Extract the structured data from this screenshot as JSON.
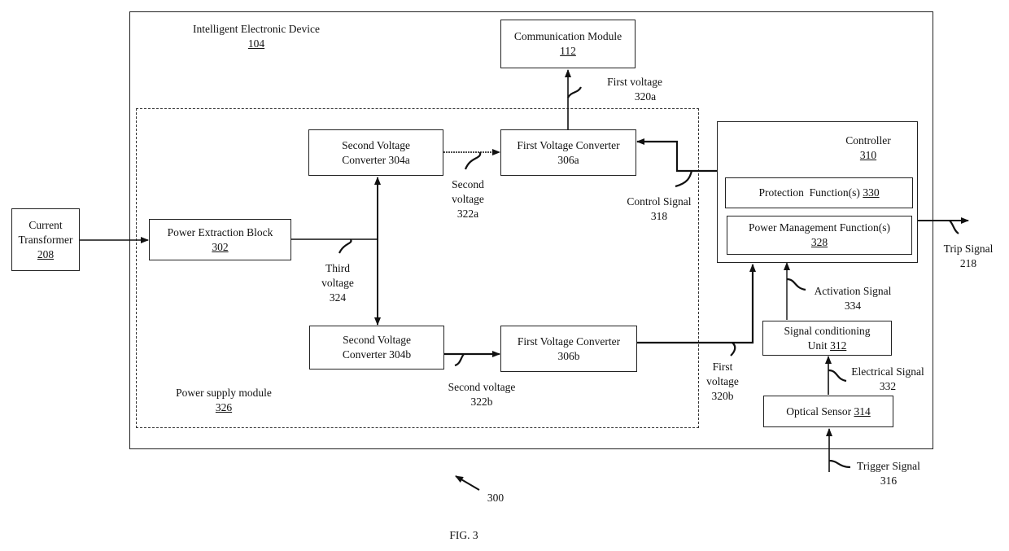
{
  "figure": {
    "caption": "FIG. 3",
    "reference": "300"
  },
  "containers": {
    "ied": {
      "title": "Intelligent Electronic  Device",
      "ref": "104"
    },
    "power_supply": {
      "title": "Power supply  module",
      "ref": "326"
    }
  },
  "blocks": {
    "current_transformer": {
      "line1": "Current",
      "line2": "Transformer",
      "ref": "208"
    },
    "power_extraction": {
      "line1": "Power Extraction Block",
      "ref": "302"
    },
    "svc_a": {
      "line1": "Second Voltage",
      "line2": "Converter 304a"
    },
    "svc_b": {
      "line1": "Second Voltage",
      "line2": "Converter 304b"
    },
    "fvc_a": {
      "line1": "First Voltage Converter",
      "line2": "306a"
    },
    "fvc_b": {
      "line1": "First Voltage Converter",
      "line2": "306b"
    },
    "comm": {
      "line1": "Communication Module",
      "ref": "112"
    },
    "controller": {
      "line1": "Controller",
      "ref": "310"
    },
    "protection": {
      "line1": "Protection  Function(s) ",
      "ref": "330"
    },
    "power_mgmt": {
      "line1": "Power Management  Function(s)",
      "ref": "328"
    },
    "signal_cond": {
      "line1": "Signal conditioning",
      "line2": "Unit ",
      "ref": "312"
    },
    "optical": {
      "line1": "Optical Sensor ",
      "ref": "314"
    }
  },
  "signals": {
    "first_voltage_a": {
      "line1": "First voltage",
      "line2": "320a"
    },
    "second_voltage_a": {
      "line1": "Second",
      "line2": "voltage",
      "line3": "322a"
    },
    "third_voltage": {
      "line1": "Third",
      "line2": "voltage",
      "line3": "324"
    },
    "control_signal": {
      "line1": "Control Signal",
      "line2": "318"
    },
    "trip_signal": {
      "line1": "Trip Signal",
      "line2": "218"
    },
    "activation_signal": {
      "line1": "Activation Signal",
      "line2": "334"
    },
    "electrical_signal": {
      "line1": "Electrical Signal",
      "line2": "332"
    },
    "second_voltage_b": {
      "line1": "Second voltage",
      "line2": "322b"
    },
    "first_voltage_b": {
      "line1": "First",
      "line2": "voltage",
      "line3": "320b"
    },
    "trigger_signal": {
      "line1": "Trigger Signal",
      "line2": "316"
    }
  }
}
